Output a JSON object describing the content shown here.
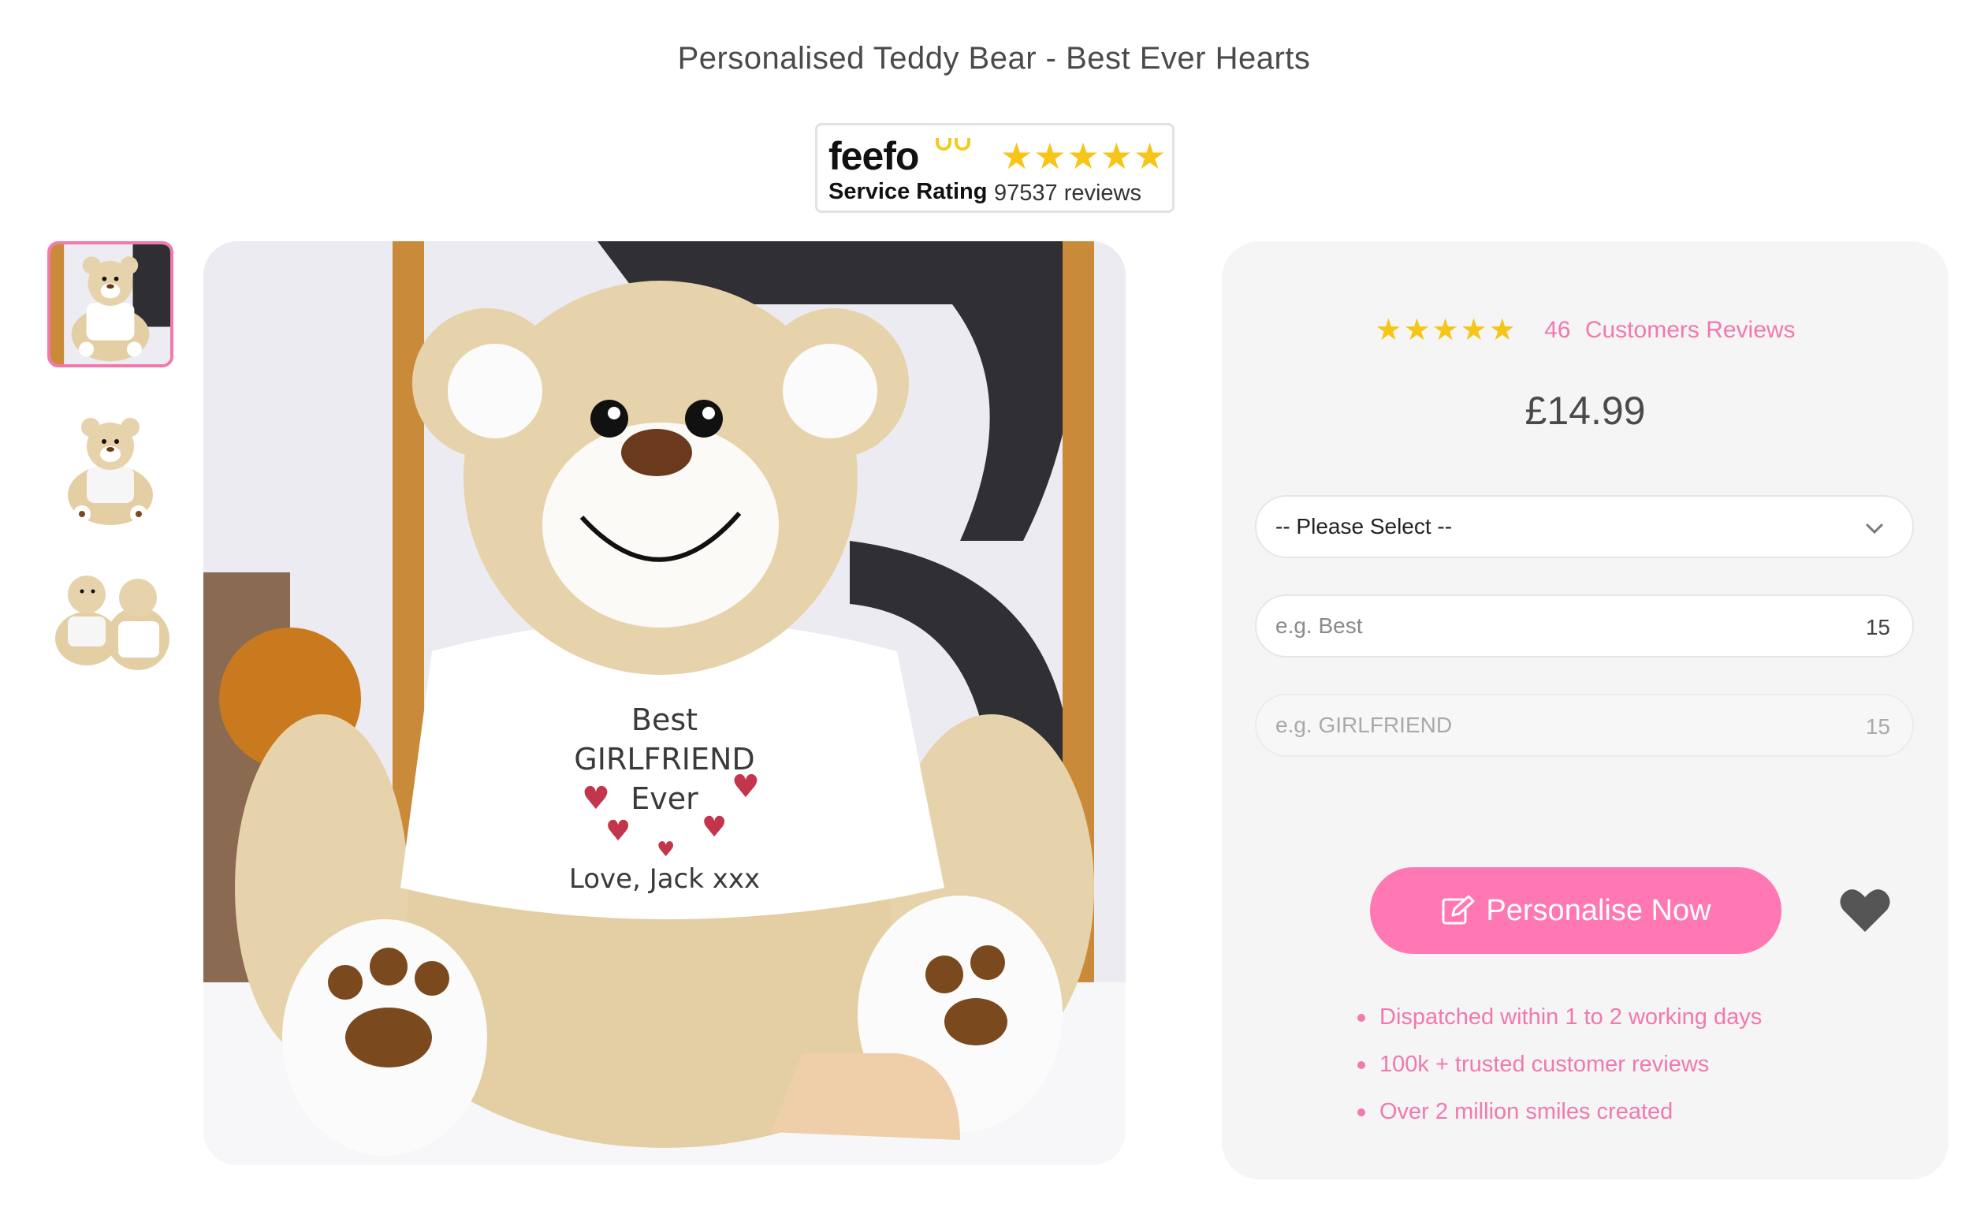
{
  "product": {
    "title": "Personalised Teddy Bear - Best Ever Hearts",
    "price": "£14.99",
    "rating_stars": "★★★★★",
    "review_count": "46",
    "reviews_label": "Customers Reviews"
  },
  "feefo": {
    "logo": "feefo",
    "service_label": "Service Rating",
    "stars": "★★★★★",
    "reviews_text": "97537 reviews",
    "brand_color": "#f3cc1b"
  },
  "gallery": {
    "thumbnails": [
      "thumbnail-1",
      "thumbnail-2",
      "thumbnail-3"
    ],
    "active_index": 0
  },
  "shirt_text": {
    "line1": "Best",
    "line2": "GIRLFRIEND",
    "line3": "Ever",
    "line4": "Love, Jack xxx"
  },
  "form": {
    "select": {
      "value": "-- Please Select --",
      "icon": "chevron-down-icon"
    },
    "line1": {
      "placeholder": "e.g. Best",
      "counter": "15"
    },
    "line2": {
      "placeholder": "e.g. GIRLFRIEND",
      "counter": "15"
    }
  },
  "cta": {
    "label": "Personalise Now",
    "icon": "edit-icon"
  },
  "wishlist": {
    "icon": "heart-icon"
  },
  "benefits": [
    "Dispatched within 1 to 2 working days",
    "100k + trusted customer reviews",
    "Over 2 million smiles created"
  ],
  "colors": {
    "accent": "#ff78b4",
    "accent_text": "#f278ae",
    "star": "#f5c518",
    "panel_bg": "#f5f5f5"
  }
}
